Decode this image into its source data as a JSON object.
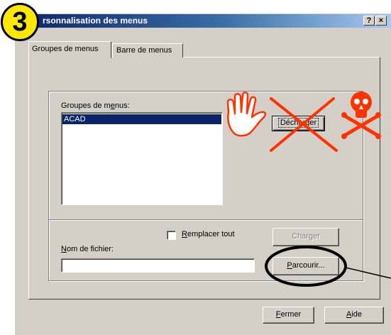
{
  "window": {
    "title": "Personnalisation des menus",
    "title_visible": "rsonnalisation des menus",
    "help_button": "?",
    "close_button": "×"
  },
  "tabs": [
    {
      "label": "Groupes de menus",
      "active": true
    },
    {
      "label": "Barre de menus",
      "active": false
    }
  ],
  "menu_groups": {
    "label_prefix": "Groupes de m",
    "label_accel": "e",
    "label_suffix": "nus:",
    "items": [
      "ACAD"
    ],
    "selected": "ACAD"
  },
  "buttons": {
    "decharger": "Décharger",
    "charger": "Charger",
    "parcourir_accel": "P",
    "parcourir_rest": "arcourir...",
    "fermer_accel": "F",
    "fermer_rest": "ermer",
    "aide_accel": "A",
    "aide_rest": "ide"
  },
  "replace_all": {
    "accel": "R",
    "rest": "emplacer tout",
    "checked": false
  },
  "filename": {
    "label_accel": "N",
    "label_rest": "om de fichier:",
    "value": ""
  },
  "annotations": {
    "step_number": "3",
    "colors": {
      "red": "#ff3300",
      "badge": "#ffe800"
    }
  }
}
